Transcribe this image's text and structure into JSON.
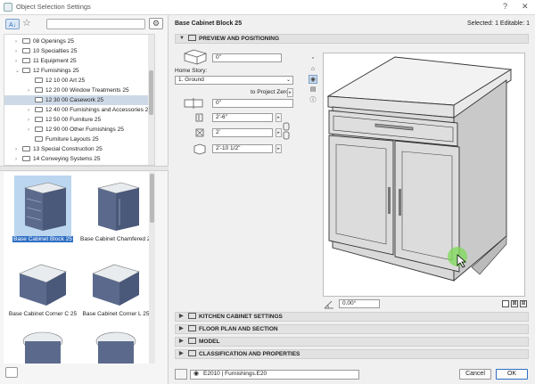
{
  "window": {
    "title": "Object Selection Settings",
    "help": "?",
    "close": "✕"
  },
  "library": {
    "search_placeholder": "",
    "tree": [
      {
        "label": "08 Openings 25",
        "indent": 1,
        "expanded": false
      },
      {
        "label": "10 Specialties 25",
        "indent": 1,
        "expanded": false
      },
      {
        "label": "11 Equipment 25",
        "indent": 1,
        "expanded": false
      },
      {
        "label": "12 Furnishings 25",
        "indent": 1,
        "expanded": true
      },
      {
        "label": "12 10 00 Art 25",
        "indent": 2,
        "expanded": null
      },
      {
        "label": "12 20 00 Window Treatments 25",
        "indent": 2,
        "expanded": false
      },
      {
        "label": "12 30 00 Casework 25",
        "indent": 2,
        "expanded": null,
        "selected": true
      },
      {
        "label": "12 40 00 Furnishings and Accessories 25",
        "indent": 2,
        "expanded": false
      },
      {
        "label": "12 50 00 Furniture 25",
        "indent": 2,
        "expanded": false
      },
      {
        "label": "12 90 00 Other Furnishings 25",
        "indent": 2,
        "expanded": false
      },
      {
        "label": "Furniture Layouts 25",
        "indent": 2,
        "expanded": null
      },
      {
        "label": "13 Special Construction 25",
        "indent": 1,
        "expanded": false
      },
      {
        "label": "14 Conveying Systems 25",
        "indent": 1,
        "expanded": false
      }
    ],
    "objects": [
      {
        "label": "Base Cabinet Block 25",
        "selected": true
      },
      {
        "label": "Base Cabinet Chamfered 25"
      },
      {
        "label": "Base Cabinet Corner C 25"
      },
      {
        "label": "Base Cabinet Corner L 25"
      },
      {
        "label": "",
        "partial": true
      },
      {
        "label": "",
        "partial": true
      }
    ]
  },
  "header": {
    "object_name": "Base Cabinet Block 25",
    "selection_info": "Selected: 1 Editable: 1"
  },
  "sections": {
    "preview": "PREVIEW AND POSITIONING",
    "kitchen": "KITCHEN CABINET SETTINGS",
    "floorplan": "FLOOR PLAN AND SECTION",
    "model": "MODEL",
    "classification": "CLASSIFICATION AND PROPERTIES"
  },
  "positioning": {
    "elevation": "0\"",
    "home_story_label": "Home Story:",
    "home_story_value": "1. Ground",
    "to_project_zero": "to Project Zero",
    "offset": "0\"",
    "dim_a": "2'-6\"",
    "dim_b": "2'",
    "dim_height": "2'-10 1/2\"",
    "rotation": "0.00°"
  },
  "footer": {
    "layer": "E2010 | Furnishings.E20",
    "cancel": "Cancel",
    "ok": "OK"
  }
}
